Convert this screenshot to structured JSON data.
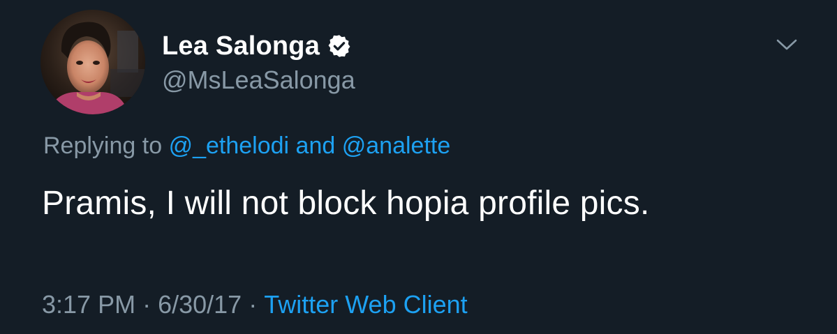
{
  "user": {
    "display_name": "Lea Salonga",
    "handle": "@MsLeaSalonga",
    "verified_icon": "verified-badge-icon",
    "avatar_icon": "profile-photo"
  },
  "reply": {
    "prefix": "Replying to",
    "mention_1": "@_ethelodi",
    "conjunction": "and",
    "mention_2": "@analette"
  },
  "tweet": {
    "text": "Pramis, I will not block hopia profile pics."
  },
  "meta": {
    "time": "3:17 PM",
    "separator_1": "·",
    "date": "6/30/17",
    "separator_2": "·",
    "client": "Twitter Web Client"
  },
  "colors": {
    "background": "#141d26",
    "primary_text": "#ffffff",
    "secondary_text": "#8899a6",
    "link": "#1da1f2"
  },
  "menu": {
    "icon": "chevron-down-icon"
  }
}
